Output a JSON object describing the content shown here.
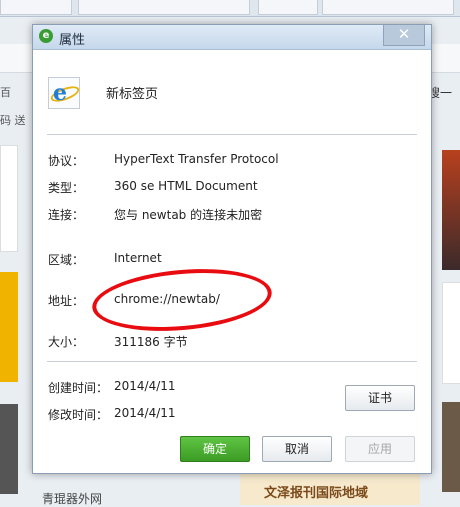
{
  "background": {
    "left_texts": [
      "网",
      "百",
      "码 送"
    ],
    "right_text": "搜一",
    "bottom_text": "青琨器外网",
    "bottom_banner": "文泽报刊国际地域"
  },
  "dialog": {
    "title": "属性",
    "close_glyph": "✕",
    "file_name": "新标签页",
    "fields": [
      {
        "label": "协议：",
        "value": "HyperText Transfer Protocol"
      },
      {
        "label": "类型：",
        "value": "360 se HTML Document"
      },
      {
        "label": "连接：",
        "value": "您与 newtab 的连接未加密"
      },
      {
        "label": "区域：",
        "value": "Internet"
      },
      {
        "label": "地址：",
        "value": "chrome://newtab/"
      },
      {
        "label": "大小：",
        "value": "311186 字节"
      },
      {
        "label": "创建时间：",
        "value": "2014/4/11"
      },
      {
        "label": "修改时间：",
        "value": "2014/4/11"
      }
    ],
    "buttons": {
      "certificate": "证书",
      "ok": "确定",
      "cancel": "取消",
      "apply": "应用"
    },
    "annotation_color": "#e80b10"
  }
}
